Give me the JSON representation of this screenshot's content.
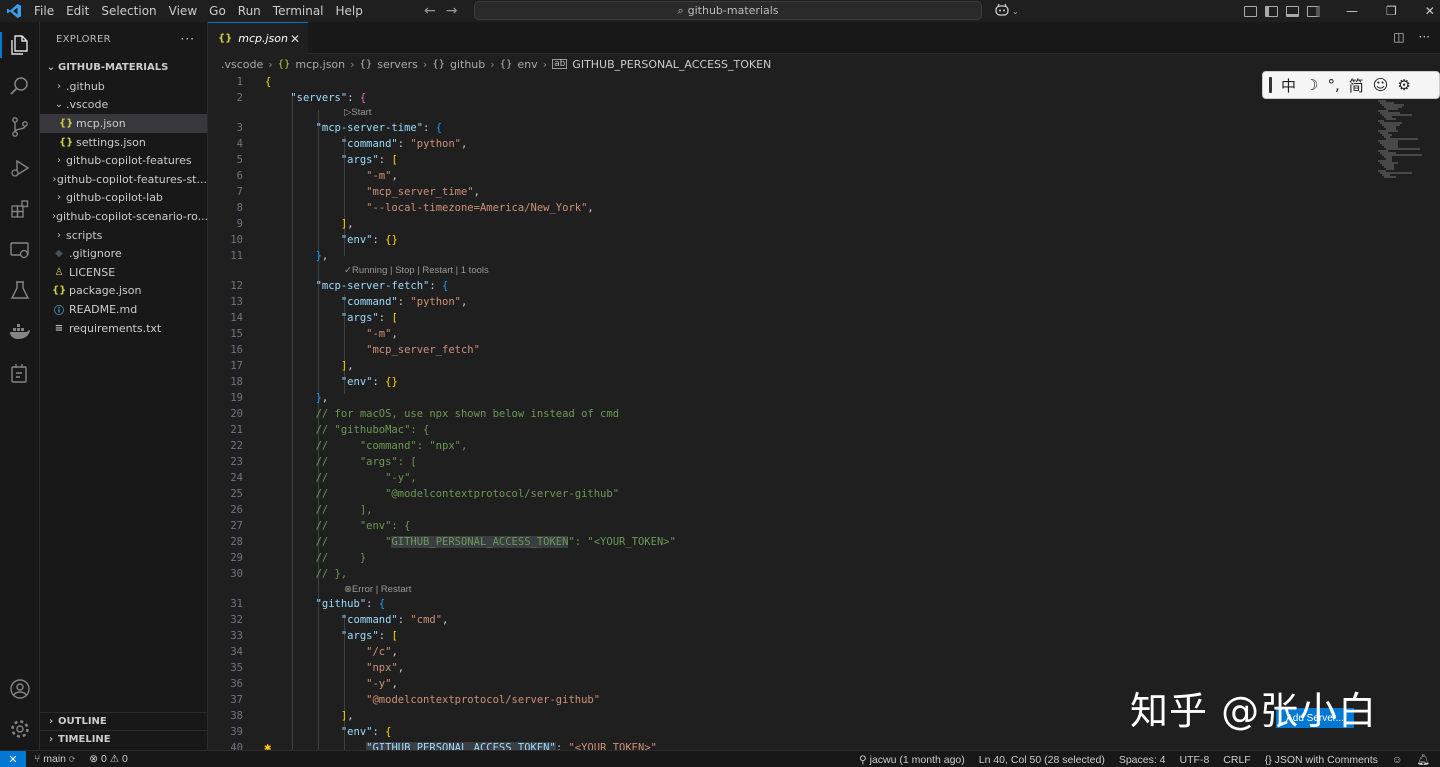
{
  "titlebar": {
    "menu": [
      "File",
      "Edit",
      "Selection",
      "View",
      "Go",
      "Run",
      "Terminal",
      "Help"
    ],
    "search_text": "github-materials",
    "colors": {
      "accent": "#0078d4",
      "logo": "#3aa1f2"
    }
  },
  "sidebar": {
    "title": "EXPLORER",
    "folder": "GITHUB-MATERIALS",
    "items": [
      {
        "label": ".github",
        "type": "folder",
        "expanded": false,
        "depth": 1
      },
      {
        "label": ".vscode",
        "type": "folder",
        "expanded": true,
        "depth": 1
      },
      {
        "label": "mcp.json",
        "type": "json",
        "depth": 2,
        "selected": true
      },
      {
        "label": "settings.json",
        "type": "json",
        "depth": 2
      },
      {
        "label": "github-copilot-features",
        "type": "folder",
        "expanded": false,
        "depth": 1
      },
      {
        "label": "github-copilot-features-st...",
        "type": "folder",
        "expanded": false,
        "depth": 1
      },
      {
        "label": "github-copilot-lab",
        "type": "folder",
        "expanded": false,
        "depth": 1
      },
      {
        "label": "github-copilot-scenario-ro...",
        "type": "folder",
        "expanded": false,
        "depth": 1
      },
      {
        "label": "scripts",
        "type": "folder",
        "expanded": false,
        "depth": 1
      },
      {
        "label": ".gitignore",
        "type": "git",
        "depth": 1
      },
      {
        "label": "LICENSE",
        "type": "license",
        "depth": 1
      },
      {
        "label": "package.json",
        "type": "json",
        "depth": 1
      },
      {
        "label": "README.md",
        "type": "info",
        "depth": 1
      },
      {
        "label": "requirements.txt",
        "type": "txt",
        "depth": 1
      }
    ],
    "outline": "OUTLINE",
    "timeline": "TIMELINE"
  },
  "tab": {
    "label": "mcp.json",
    "icon": "{}"
  },
  "breadcrumb": [
    ".vscode",
    "mcp.json",
    "servers",
    "github",
    "env",
    "GITHUB_PERSONAL_ACCESS_TOKEN"
  ],
  "codelens": {
    "time": "▷Start",
    "fetch": "✓Running | Stop | Restart | 1 tools",
    "github": "⊗Error | Restart"
  },
  "code": {
    "lines": [
      {
        "n": "1",
        "tokens": [
          [
            "b1",
            "{"
          ]
        ]
      },
      {
        "n": "2",
        "tokens": [
          [
            "p",
            "    "
          ],
          [
            "k",
            "\"servers\""
          ],
          [
            "p",
            ": "
          ],
          [
            "b2",
            "{"
          ]
        ]
      },
      {
        "n": "3",
        "tokens": [
          [
            "p",
            "        "
          ],
          [
            "k",
            "\"mcp-server-time\""
          ],
          [
            "p",
            ": "
          ],
          [
            "b3",
            "{"
          ]
        ]
      },
      {
        "n": "4",
        "tokens": [
          [
            "p",
            "            "
          ],
          [
            "k",
            "\"command\""
          ],
          [
            "p",
            ": "
          ],
          [
            "s",
            "\"python\""
          ],
          [
            "p",
            ","
          ]
        ]
      },
      {
        "n": "5",
        "tokens": [
          [
            "p",
            "            "
          ],
          [
            "k",
            "\"args\""
          ],
          [
            "p",
            ": "
          ],
          [
            "b1",
            "["
          ]
        ]
      },
      {
        "n": "6",
        "tokens": [
          [
            "p",
            "                "
          ],
          [
            "s",
            "\"-m\""
          ],
          [
            "p",
            ","
          ]
        ]
      },
      {
        "n": "7",
        "tokens": [
          [
            "p",
            "                "
          ],
          [
            "s",
            "\"mcp_server_time\""
          ],
          [
            "p",
            ","
          ]
        ]
      },
      {
        "n": "8",
        "tokens": [
          [
            "p",
            "                "
          ],
          [
            "s",
            "\"--local-timezone=America/New_York\""
          ],
          [
            "p",
            ","
          ]
        ]
      },
      {
        "n": "9",
        "tokens": [
          [
            "p",
            "            "
          ],
          [
            "b1",
            "]"
          ],
          [
            "p",
            ","
          ]
        ]
      },
      {
        "n": "10",
        "tokens": [
          [
            "p",
            "            "
          ],
          [
            "k",
            "\"env\""
          ],
          [
            "p",
            ": "
          ],
          [
            "b1",
            "{}"
          ]
        ]
      },
      {
        "n": "11",
        "tokens": [
          [
            "p",
            "        "
          ],
          [
            "b3",
            "}"
          ],
          [
            "p",
            ","
          ]
        ]
      },
      {
        "n": "12",
        "tokens": [
          [
            "p",
            "        "
          ],
          [
            "k",
            "\"mcp-server-fetch\""
          ],
          [
            "p",
            ": "
          ],
          [
            "b3",
            "{"
          ]
        ]
      },
      {
        "n": "13",
        "tokens": [
          [
            "p",
            "            "
          ],
          [
            "k",
            "\"command\""
          ],
          [
            "p",
            ": "
          ],
          [
            "s",
            "\"python\""
          ],
          [
            "p",
            ","
          ]
        ]
      },
      {
        "n": "14",
        "tokens": [
          [
            "p",
            "            "
          ],
          [
            "k",
            "\"args\""
          ],
          [
            "p",
            ": "
          ],
          [
            "b1",
            "["
          ]
        ]
      },
      {
        "n": "15",
        "tokens": [
          [
            "p",
            "                "
          ],
          [
            "s",
            "\"-m\""
          ],
          [
            "p",
            ","
          ]
        ]
      },
      {
        "n": "16",
        "tokens": [
          [
            "p",
            "                "
          ],
          [
            "s",
            "\"mcp_server_fetch\""
          ]
        ]
      },
      {
        "n": "17",
        "tokens": [
          [
            "p",
            "            "
          ],
          [
            "b1",
            "]"
          ],
          [
            "p",
            ","
          ]
        ]
      },
      {
        "n": "18",
        "tokens": [
          [
            "p",
            "            "
          ],
          [
            "k",
            "\"env\""
          ],
          [
            "p",
            ": "
          ],
          [
            "b1",
            "{}"
          ]
        ]
      },
      {
        "n": "19",
        "tokens": [
          [
            "p",
            "        "
          ],
          [
            "b3",
            "}"
          ],
          [
            "p",
            ","
          ]
        ]
      },
      {
        "n": "20",
        "tokens": [
          [
            "p",
            "        "
          ],
          [
            "c",
            "// for macOS, use npx shown below instead of cmd"
          ]
        ]
      },
      {
        "n": "21",
        "tokens": [
          [
            "p",
            "        "
          ],
          [
            "c",
            "// \"githuboMac\": {"
          ]
        ]
      },
      {
        "n": "22",
        "tokens": [
          [
            "p",
            "        "
          ],
          [
            "c",
            "//     \"command\": \"npx\","
          ]
        ]
      },
      {
        "n": "23",
        "tokens": [
          [
            "p",
            "        "
          ],
          [
            "c",
            "//     \"args\": ["
          ]
        ]
      },
      {
        "n": "24",
        "tokens": [
          [
            "p",
            "        "
          ],
          [
            "c",
            "//         \"-y\","
          ]
        ]
      },
      {
        "n": "25",
        "tokens": [
          [
            "p",
            "        "
          ],
          [
            "c",
            "//         \"@modelcontextprotocol/server-github\""
          ]
        ]
      },
      {
        "n": "26",
        "tokens": [
          [
            "p",
            "        "
          ],
          [
            "c",
            "//     ],"
          ]
        ]
      },
      {
        "n": "27",
        "tokens": [
          [
            "p",
            "        "
          ],
          [
            "c",
            "//     \"env\": {"
          ]
        ]
      },
      {
        "n": "28",
        "tokens": [
          [
            "p",
            "        "
          ],
          [
            "c",
            "//         \""
          ],
          [
            "c hl",
            "GITHUB_PERSONAL_ACCESS_TOKEN"
          ],
          [
            "c",
            "\": \"<YOUR_TOKEN>\""
          ]
        ]
      },
      {
        "n": "29",
        "tokens": [
          [
            "p",
            "        "
          ],
          [
            "c",
            "//     }"
          ]
        ]
      },
      {
        "n": "30",
        "tokens": [
          [
            "p",
            "        "
          ],
          [
            "c",
            "// },"
          ]
        ]
      },
      {
        "n": "31",
        "tokens": [
          [
            "p",
            "        "
          ],
          [
            "k",
            "\"github\""
          ],
          [
            "p",
            ": "
          ],
          [
            "b3",
            "{"
          ]
        ]
      },
      {
        "n": "32",
        "tokens": [
          [
            "p",
            "            "
          ],
          [
            "k",
            "\"command\""
          ],
          [
            "p",
            ": "
          ],
          [
            "s",
            "\"cmd\""
          ],
          [
            "p",
            ","
          ]
        ]
      },
      {
        "n": "33",
        "tokens": [
          [
            "p",
            "            "
          ],
          [
            "k",
            "\"args\""
          ],
          [
            "p",
            ": "
          ],
          [
            "b1",
            "["
          ]
        ]
      },
      {
        "n": "34",
        "tokens": [
          [
            "p",
            "                "
          ],
          [
            "s",
            "\"/c\""
          ],
          [
            "p",
            ","
          ]
        ]
      },
      {
        "n": "35",
        "tokens": [
          [
            "p",
            "                "
          ],
          [
            "s",
            "\"npx\""
          ],
          [
            "p",
            ","
          ]
        ]
      },
      {
        "n": "36",
        "tokens": [
          [
            "p",
            "                "
          ],
          [
            "s",
            "\"-y\""
          ],
          [
            "p",
            ","
          ]
        ]
      },
      {
        "n": "37",
        "tokens": [
          [
            "p",
            "                "
          ],
          [
            "s",
            "\"@modelcontextprotocol/server-github\""
          ]
        ]
      },
      {
        "n": "38",
        "tokens": [
          [
            "p",
            "            "
          ],
          [
            "b1",
            "]"
          ],
          [
            "p",
            ","
          ]
        ]
      },
      {
        "n": "39",
        "tokens": [
          [
            "p",
            "            "
          ],
          [
            "k",
            "\"env\""
          ],
          [
            "p",
            ": "
          ],
          [
            "b1",
            "{"
          ]
        ]
      },
      {
        "n": "40",
        "tokens": [
          [
            "p",
            "                "
          ],
          [
            "k hl",
            "\"GITHUB_PERSONAL_ACCESS_TOKEN\""
          ],
          [
            "p",
            ": "
          ],
          [
            "s",
            "\"<YOUR_TOKEN>\""
          ]
        ]
      }
    ]
  },
  "ime": {
    "items": [
      "中",
      "☽",
      "°,",
      "简",
      "☺",
      "⚙"
    ]
  },
  "watermark": "知乎 @张小白",
  "add_server_label": "Add Server...",
  "statusbar": {
    "branch": "main",
    "problems": "⊗ 0 ⚠ 0",
    "blame": "jacwu (1 month ago)",
    "position": "Ln 40, Col 50 (28 selected)",
    "spaces": "Spaces: 4",
    "encoding": "UTF-8",
    "eol": "CRLF",
    "language": "JSON with Comments"
  }
}
